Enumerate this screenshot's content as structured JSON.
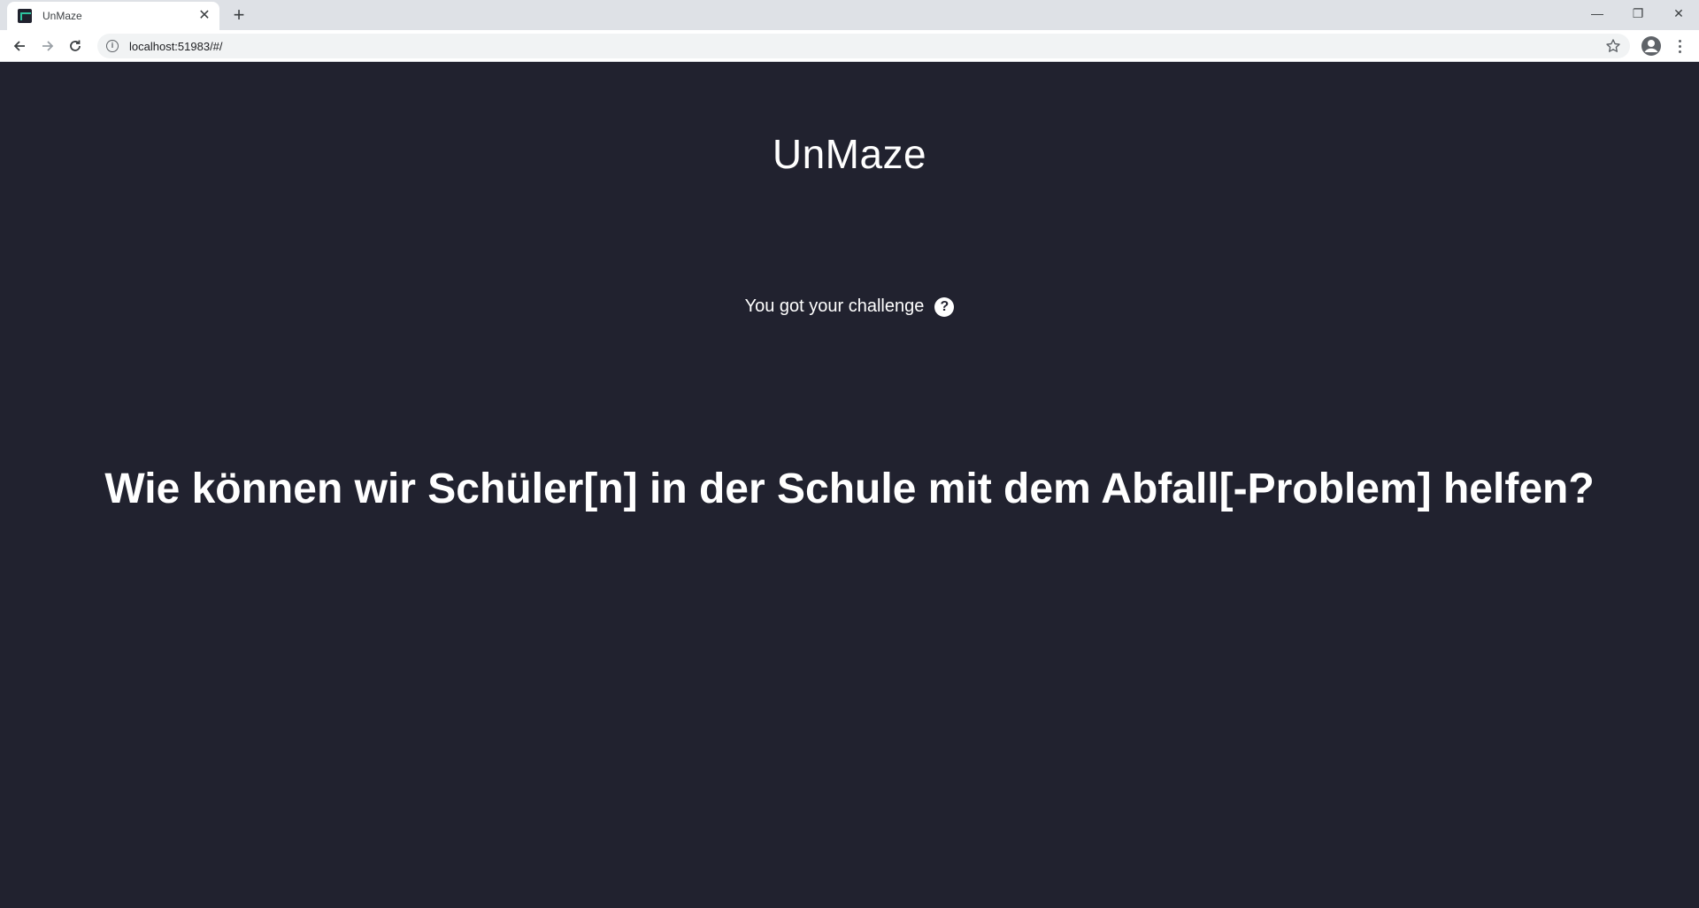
{
  "browser": {
    "tab": {
      "title": "UnMaze",
      "close_glyph": "✕"
    },
    "new_tab_glyph": "+",
    "window_controls": {
      "minimize_glyph": "—",
      "restore_glyph": "❐",
      "close_glyph": "✕"
    },
    "address_bar": {
      "url": "localhost:51983/#/"
    },
    "icons": {
      "back": "back-arrow-icon",
      "forward": "forward-arrow-icon",
      "reload": "reload-icon",
      "info": "info-icon",
      "star": "star-icon",
      "profile": "profile-icon",
      "menu": "more-vert-icon"
    }
  },
  "app": {
    "title": "UnMaze",
    "status_text": "You got your challenge",
    "help_glyph": "?",
    "challenge_text": "Wie können wir Schüler[n] in der Schule mit dem Abfall[-Problem] helfen?"
  },
  "colors": {
    "page_background": "#21222f",
    "text": "#ffffff",
    "tabstrip_background": "#dee1e6"
  }
}
